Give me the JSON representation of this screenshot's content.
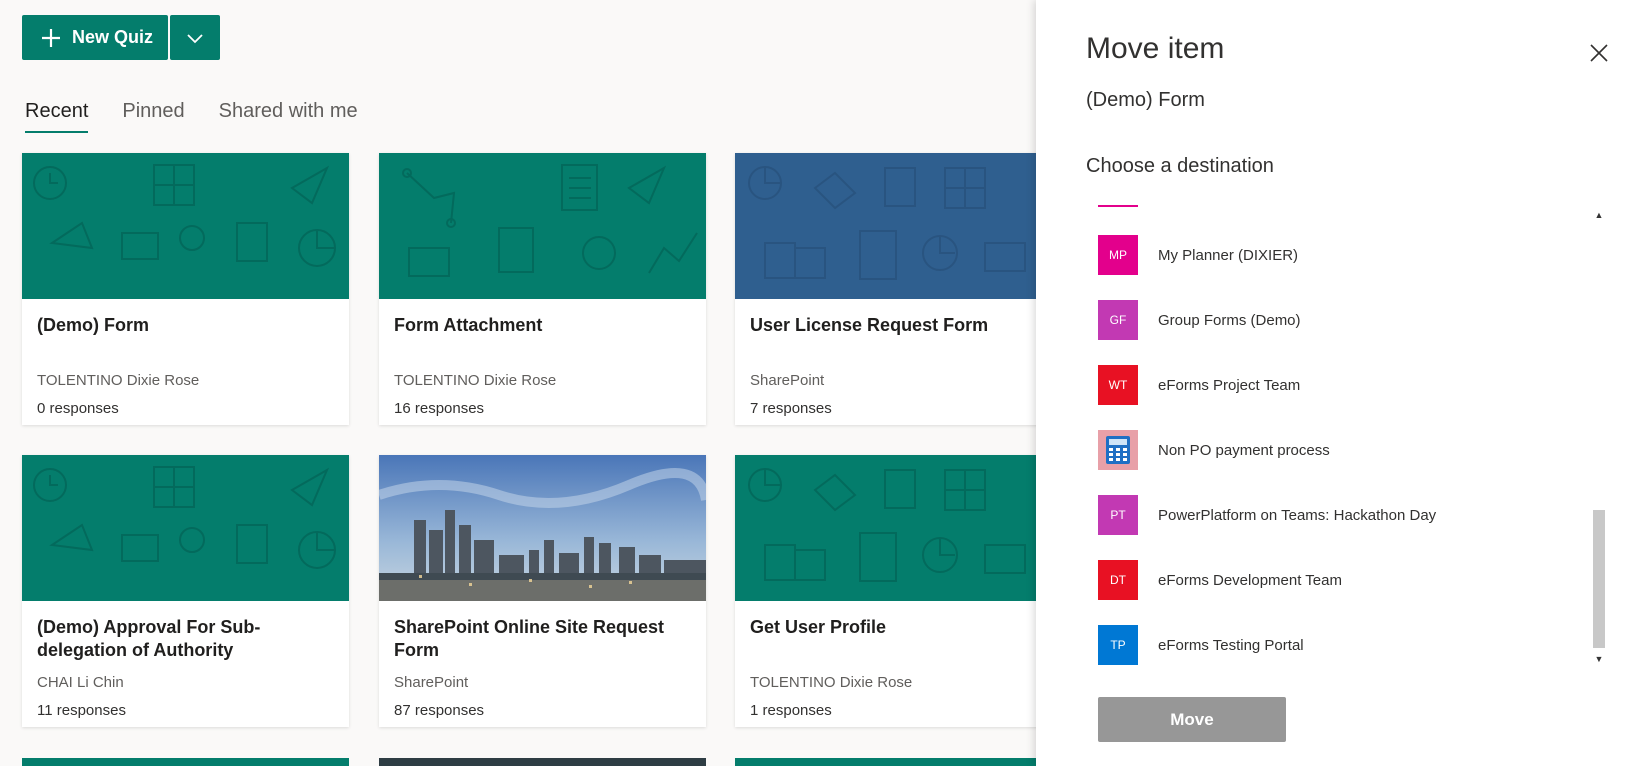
{
  "toolbar": {
    "new_quiz_label": "New Quiz"
  },
  "tabs": [
    {
      "label": "Recent",
      "active": true
    },
    {
      "label": "Pinned",
      "active": false
    },
    {
      "label": "Shared with me",
      "active": false
    }
  ],
  "cards": [
    {
      "title": "(Demo) Form",
      "owner": "TOLENTINO Dixie Rose",
      "responses": "0 responses",
      "theme": "#047d6c"
    },
    {
      "title": "Form Attachment",
      "owner": "TOLENTINO Dixie Rose",
      "responses": "16 responses",
      "theme": "#047d6c"
    },
    {
      "title": "User License Request Form",
      "owner": "SharePoint",
      "responses": "7 responses",
      "theme": "#2f5f8f"
    },
    {
      "title": "(Demo) Approval For Sub-delegation of Authority",
      "owner": "CHAI Li Chin",
      "responses": "11 responses",
      "theme": "#047d6c"
    },
    {
      "title": "SharePoint Online Site Request Form",
      "owner": "SharePoint",
      "responses": "87 responses",
      "theme": "photo"
    },
    {
      "title": "Get User Profile",
      "owner": "TOLENTINO Dixie Rose",
      "responses": "1 responses",
      "theme": "#047d6c"
    }
  ],
  "panel": {
    "title": "Move item",
    "item_name": "(Demo) Form",
    "choose_label": "Choose a destination",
    "move_label": "Move",
    "destinations": [
      {
        "initials": "MP",
        "label": "My Planner (DIXIER)",
        "color": "#e3008c"
      },
      {
        "initials": "GF",
        "label": "Group Forms (Demo)",
        "color": "#c239b3"
      },
      {
        "initials": "WT",
        "label": "eForms Project Team",
        "color": "#e81123"
      },
      {
        "initials": "",
        "label": "Non PO payment process",
        "color": "#e8a0a8",
        "icon": "calculator-icon"
      },
      {
        "initials": "PT",
        "label": "PowerPlatform on Teams: Hackathon Day",
        "color": "#c239b3"
      },
      {
        "initials": "DT",
        "label": "eForms Development Team",
        "color": "#e81123"
      },
      {
        "initials": "TP",
        "label": "eForms Testing Portal",
        "color": "#0078d4"
      }
    ]
  }
}
